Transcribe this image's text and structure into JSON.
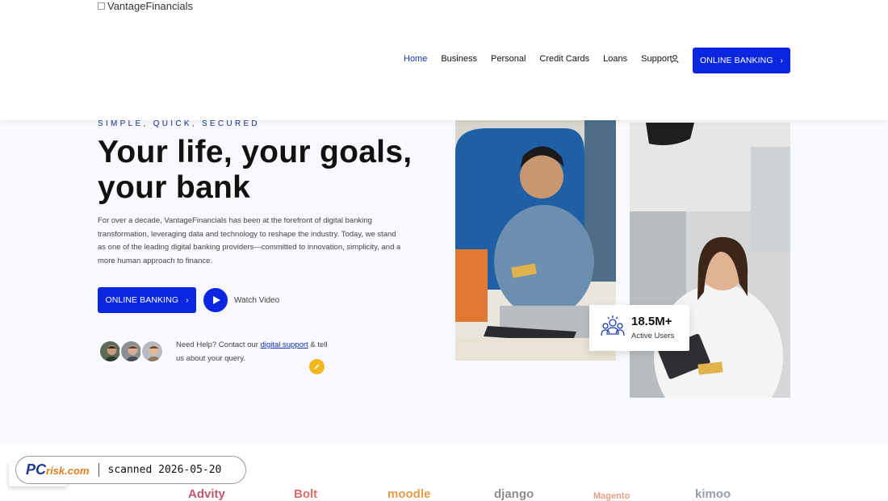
{
  "header": {
    "logo_alt": "VantageFinancials",
    "nav": [
      {
        "label": "Home",
        "active": true
      },
      {
        "label": "Business",
        "active": false
      },
      {
        "label": "Personal",
        "active": false
      },
      {
        "label": "Credit Cards",
        "active": false
      },
      {
        "label": "Loans",
        "active": false
      },
      {
        "label": "Support",
        "active": false
      }
    ],
    "user_icon": "user-icon",
    "cta_label": "ONLINE BANKING"
  },
  "hero": {
    "eyebrow": "SIMPLE, QUICK, SECURED",
    "title": "Your life, your goals, your bank",
    "description": "For over a decade, VantageFinancials has been at the forefront of digital banking transformation, leveraging data and technology to reshape the industry. Today, we stand as one of the leading digital banking providers—committed to innovation, simplicity, and a more human approach to finance.",
    "cta_label": "ONLINE BANKING",
    "watch_label": "Watch Video",
    "help_prefix": "Need Help? Contact our ",
    "help_link": "digital support",
    "help_suffix": " & tell us about your query."
  },
  "stats": {
    "value": "18.5M+",
    "label": "Active Users",
    "icon": "users-group-icon"
  },
  "brands": [
    "Advity",
    "Bolt",
    "moodle",
    "django",
    "Magento",
    "kimoo"
  ],
  "watermark": {
    "logo": "PC",
    "logo_suffix": "risk.com",
    "text": "scanned 2026-05-20"
  },
  "colors": {
    "accent": "#0a26e0",
    "nav_active": "#1531b8",
    "page_bg": "#f8f9fc"
  }
}
